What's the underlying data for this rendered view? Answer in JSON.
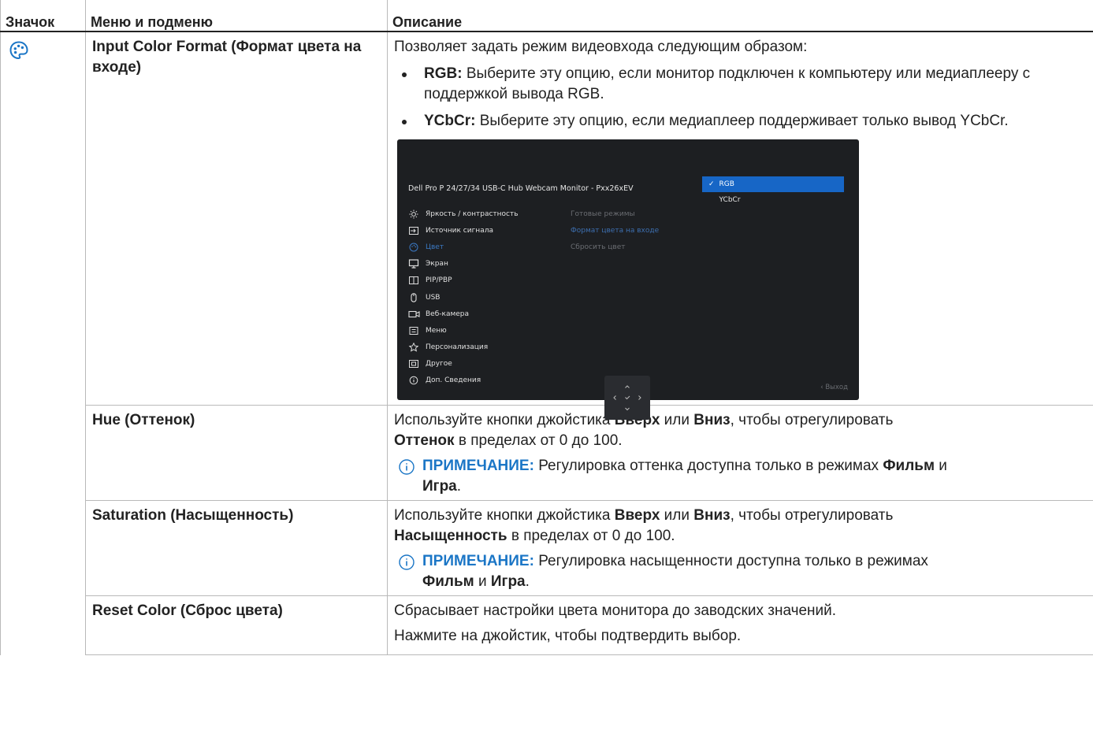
{
  "table": {
    "headers": {
      "icon": "Значок",
      "menu": "Меню и подменю",
      "description": "Описание"
    },
    "rows": {
      "input_color_format": {
        "menu": "Input Color Format (Формат цвета на входе)",
        "intro": "Позволяет задать режим видеовхода следующим образом:",
        "options": [
          {
            "label": "RGB:",
            "text": " Выберите эту опцию, если монитор подключен к компьютеру или медиаплееру с поддержкой вывода RGB."
          },
          {
            "label": "YCbCr:",
            "text": " Выберите эту опцию, если медиаплеер поддерживает только вывод YCbCr."
          }
        ]
      },
      "hue": {
        "menu": "Hue (Оттенок)",
        "p1": "Используйте кнопки джойстика ",
        "b1": "Вверх",
        "p2": " или ",
        "b2": "Вниз",
        "p3": ", чтобы отрегулировать ",
        "b3": "Оттенок",
        "p4": " в пределах от 0 до 100.",
        "note_label": "ПРИМЕЧАНИЕ:",
        "note_text": " Регулировка оттенка доступна только в режимах ",
        "note_b1": "Фильм",
        "note_and": " и ",
        "note_b2": "Игра",
        "note_end": "."
      },
      "saturation": {
        "menu": "Saturation (Насыщенность)",
        "p1": "Используйте кнопки джойстика ",
        "b1": "Вверх",
        "p2": " или ",
        "b2": "Вниз",
        "p3": ", чтобы отрегулировать ",
        "b3": "Насыщенность",
        "p4": " в пределах от 0 до 100.",
        "note_label": "ПРИМЕЧАНИЕ:",
        "note_text": " Регулировка насыщенности доступна только в режимах ",
        "note_b1": "Фильм",
        "note_and": " и ",
        "note_b2": "Игра",
        "note_end": "."
      },
      "reset_color": {
        "menu": "Reset Color (Сброс цвета)",
        "p1": "Сбрасывает настройки цвета монитора до заводских значений.",
        "p2": "Нажмите на джойстик, чтобы подтвердить выбор."
      }
    }
  },
  "osd": {
    "title": "Dell Pro P 24/27/34 USB-C Hub Webcam Monitor - Pxx26xEV",
    "menu": [
      {
        "label": "Яркость / контрастность",
        "icon": "brightness-icon"
      },
      {
        "label": "Источник сигнала",
        "icon": "input-source-icon"
      },
      {
        "label": "Цвет",
        "icon": "color-palette-icon"
      },
      {
        "label": "Экран",
        "icon": "display-icon"
      },
      {
        "label": "PIP/PBP",
        "icon": "pip-icon"
      },
      {
        "label": "USB",
        "icon": "mouse-icon"
      },
      {
        "label": "Веб-камера",
        "icon": "webcam-icon"
      },
      {
        "label": "Меню",
        "icon": "menu-icon"
      },
      {
        "label": "Персонализация",
        "icon": "star-icon"
      },
      {
        "label": "Другое",
        "icon": "other-icon"
      },
      {
        "label": "Доп. Сведения",
        "icon": "info-icon"
      }
    ],
    "submenu": [
      "Готовые режимы",
      "Формат цвета на входе",
      "Сбросить цвет"
    ],
    "options": [
      "RGB",
      "YCbCr"
    ],
    "exit": "‹ Выход",
    "colors": {
      "accent": "#1766c6",
      "background": "#1d1f22"
    }
  }
}
